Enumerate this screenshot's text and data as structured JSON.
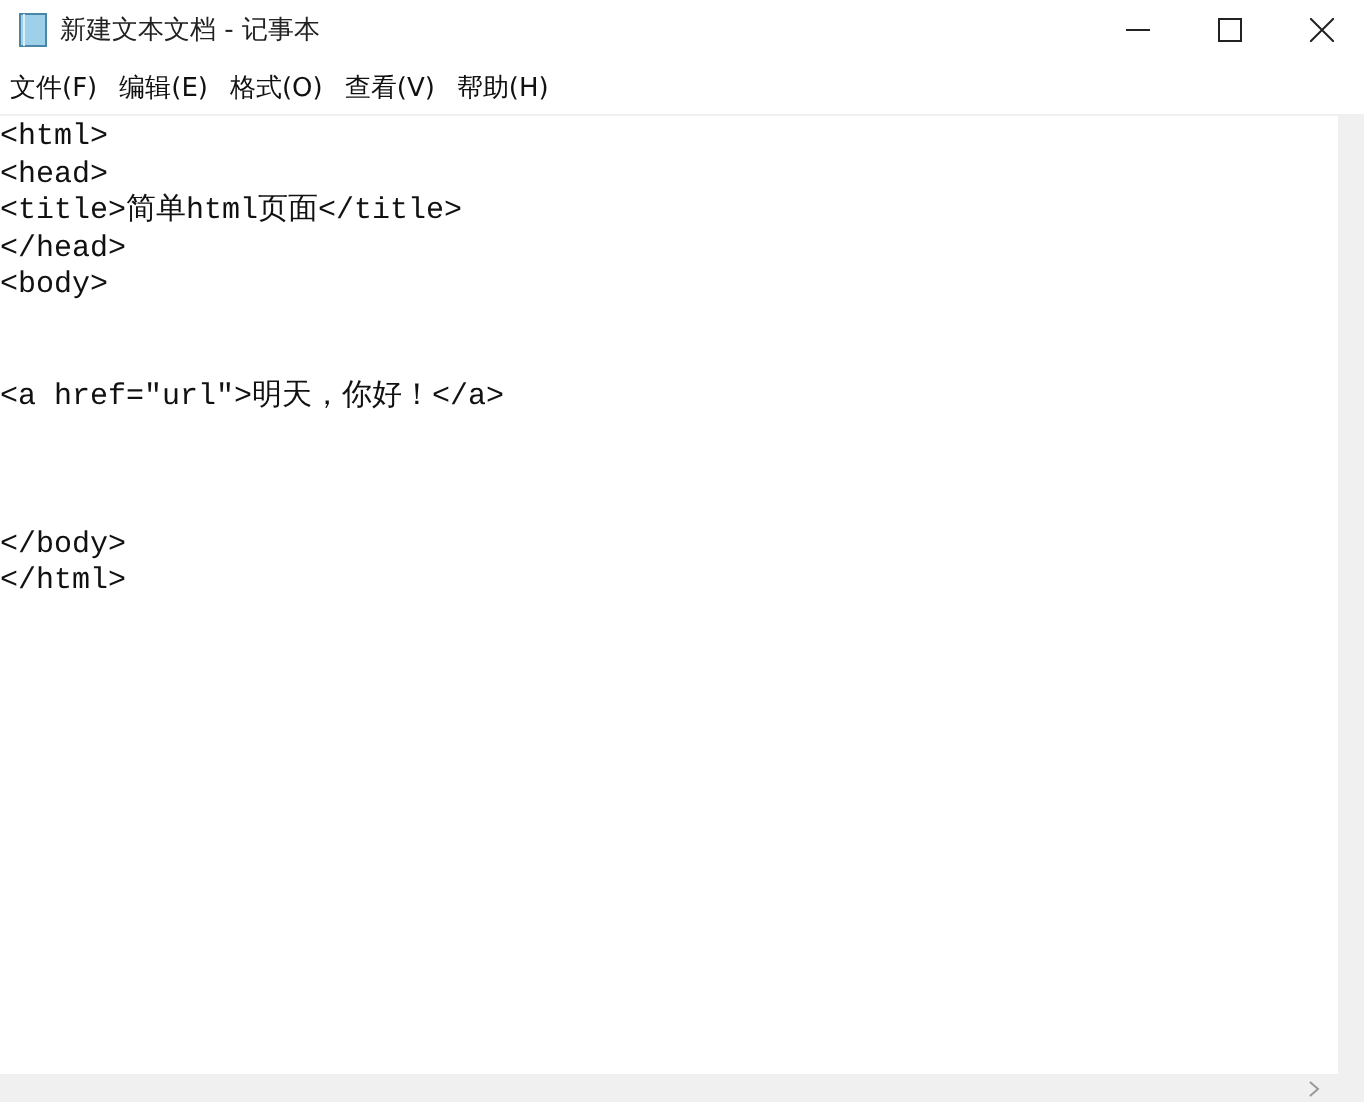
{
  "window": {
    "title": "新建文本文档 - 记事本"
  },
  "menu": [
    "文件(F)",
    "编辑(E)",
    "格式(O)",
    "查看(V)",
    "帮助(H)"
  ],
  "editor": {
    "text": "<html>\n<head>\n<title>简单html页面</title>\n</head>\n<body>\n\n\n<a href=\"url\">明天，你好！</a>\n\n\n\n</body>\n</html>"
  }
}
